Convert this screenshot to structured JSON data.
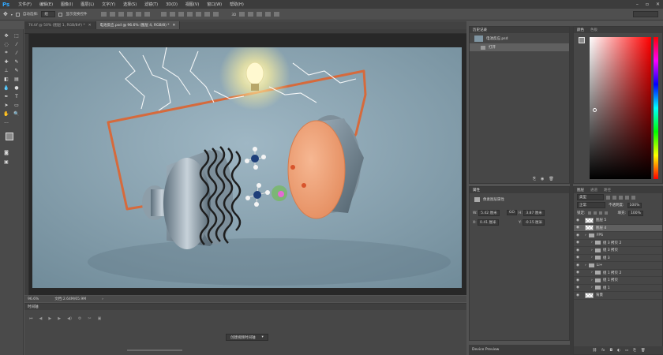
{
  "app": {
    "logo": "Ps"
  },
  "menu": [
    "文件(F)",
    "编辑(E)",
    "图像(I)",
    "图层(L)",
    "文字(Y)",
    "选择(S)",
    "滤镜(T)",
    "3D(D)",
    "视图(V)",
    "窗口(W)",
    "帮助(H)"
  ],
  "options": {
    "auto_select": "自动选择:",
    "group_value": "组",
    "show_transform": "显示变换控件"
  },
  "tabs": [
    {
      "label": "74.tif @ 50% (图层 1, RGB/8#) *"
    },
    {
      "label": "电池反应.psd @ 96.6% (图层 4, RGB/8) *"
    }
  ],
  "status": {
    "zoom": "96.6%",
    "doc": "文档:2.64M/65.9M"
  },
  "timeline": {
    "title": "时间轴",
    "create_button": "创建视频时间轴"
  },
  "history": {
    "title": "历史记录",
    "snapshot": "电池反应.psd",
    "items": [
      "打开"
    ]
  },
  "properties": {
    "title": "属性",
    "type": "像素图层属性",
    "w_label": "W:",
    "w_value": "5.42 厘米",
    "go_label": "GO",
    "h_label": "H:",
    "h_value": "3.87 厘米",
    "x_label": "X:",
    "x_value": "0.41 厘米",
    "y_label": "Y:",
    "y_value": "-0.15 厘米"
  },
  "device_preview": "Device Preview",
  "color_panel": {
    "tabs": [
      "颜色",
      "色板"
    ],
    "fg": "#8a8a8a",
    "bg": "#1fd0e0"
  },
  "layers_panel": {
    "tabs": [
      "图层",
      "通道",
      "路径"
    ],
    "filter_label": "类型",
    "blend_mode": "正常",
    "opacity_label": "不透明度:",
    "opacity": "100%",
    "lock_label": "锁定:",
    "fill_label": "填充:",
    "fill": "100%",
    "layers": [
      {
        "name": "图层 5",
        "kind": "layer",
        "indent": 0,
        "selected": false
      },
      {
        "name": "图层 4",
        "kind": "layer",
        "indent": 0,
        "selected": true
      },
      {
        "name": "FPS",
        "kind": "group",
        "indent": 0,
        "selected": false
      },
      {
        "name": "组 3 拷贝 2",
        "kind": "group",
        "indent": 1,
        "selected": false
      },
      {
        "name": "组 3 拷贝",
        "kind": "group",
        "indent": 1,
        "selected": false
      },
      {
        "name": "组 3",
        "kind": "group",
        "indent": 1,
        "selected": false
      },
      {
        "name": "Li+",
        "kind": "group",
        "indent": 0,
        "selected": false
      },
      {
        "name": "组 1 拷贝 2",
        "kind": "group",
        "indent": 1,
        "selected": false
      },
      {
        "name": "组 1 拷贝",
        "kind": "group",
        "indent": 1,
        "selected": false
      },
      {
        "name": "组 1",
        "kind": "group",
        "indent": 1,
        "selected": false
      },
      {
        "name": "背景",
        "kind": "layer",
        "indent": 0,
        "selected": false
      }
    ]
  }
}
